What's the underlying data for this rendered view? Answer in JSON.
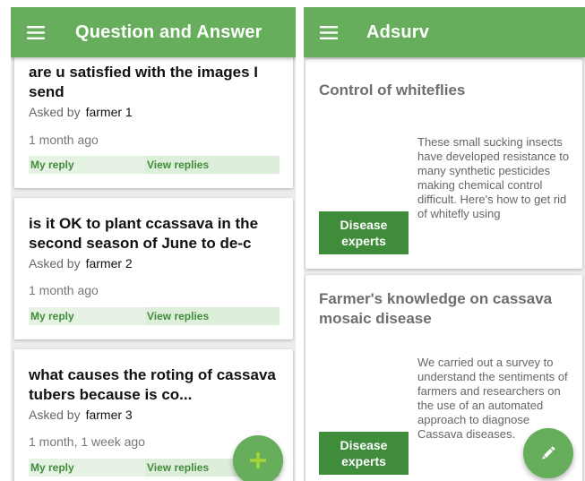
{
  "qa_screen": {
    "title": "Question and Answer",
    "questions": [
      {
        "title": "are u satisfied with the images I send",
        "asked_by_label": "Asked by",
        "farmer": "farmer 1",
        "time": "1 month ago",
        "reply_label": "My reply",
        "view_label": "View replies"
      },
      {
        "title": "is it OK to plant ccassava in the second season of June to de-c",
        "asked_by_label": "Asked by",
        "farmer": "farmer 2",
        "time": "1 month ago",
        "reply_label": "My reply",
        "view_label": "View replies"
      },
      {
        "title": "what causes the roting of cassava tubers because is co...",
        "asked_by_label": "Asked by",
        "farmer": "farmer 3",
        "time": "1 month, 1 week ago",
        "reply_label": "My reply",
        "view_label": "View replies"
      }
    ],
    "fab_icon": "plus-icon"
  },
  "adsurv_screen": {
    "title": "Adsurv",
    "articles": [
      {
        "title": "Control of whiteflies",
        "text": "These small sucking insects have developed resistance to many synthetic pesticides making chemical control difficult. Here's how to get rid of whitefly using",
        "button_label": "Disease experts"
      },
      {
        "title": "Farmer's knowledge on cassava mosaic disease",
        "text": "We carried out a survey to understand the sentiments of farmers and researchers on the use of an automated approach to diagnose Cassava diseases.",
        "button_label": "Disease experts"
      }
    ],
    "fab_icon": "pencil-icon"
  },
  "colors": {
    "primary": "#66ae5b",
    "primary_dark": "#3f8c3a",
    "action_bg": "#e6f2e3",
    "fab_plus": "#a4d43a"
  }
}
